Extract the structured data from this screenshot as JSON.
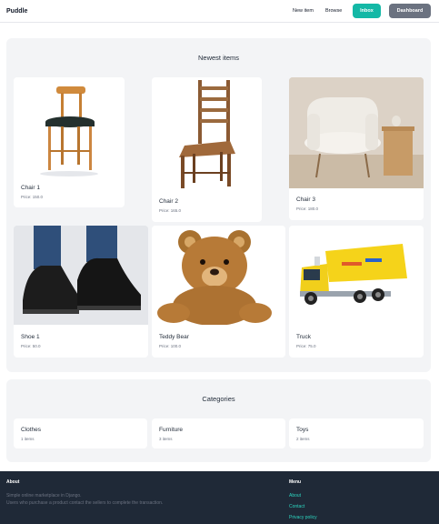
{
  "nav": {
    "brand": "Puddle",
    "new_item": "New item",
    "browse": "Browse",
    "inbox": "Inbox",
    "dashboard": "Dashboard"
  },
  "newest": {
    "title": "Newest items",
    "items": [
      {
        "name": "Chair 1",
        "price": "Price: 150.0",
        "image": "chair-1-image"
      },
      {
        "name": "Chair 2",
        "price": "Price: 165.0",
        "image": "chair-2-image"
      },
      {
        "name": "Chair 3",
        "price": "Price: 180.0",
        "image": "chair-3-image"
      },
      {
        "name": "Shoe 1",
        "price": "Price: 50.0",
        "image": "shoe-1-image"
      },
      {
        "name": "Teddy Bear",
        "price": "Price: 100.0",
        "image": "teddy-bear-image"
      },
      {
        "name": "Truck",
        "price": "Price: 75.0",
        "image": "truck-image"
      }
    ]
  },
  "categories": {
    "title": "Categories",
    "items": [
      {
        "name": "Clothes",
        "count": "1 items"
      },
      {
        "name": "Furniture",
        "count": "3 items"
      },
      {
        "name": "Toys",
        "count": "2 items"
      }
    ]
  },
  "footer": {
    "about_heading": "About",
    "about_line1": "Simple online marketplace in Django.",
    "about_line2": "Users who purchase a product contact the sellers to complete the transaction.",
    "menu_heading": "Menu",
    "links": [
      "About",
      "Contact",
      "Privacy policy"
    ]
  },
  "colors": {
    "accent": "#14b8a6",
    "dashboard_button": "#6b7280",
    "footer_bg": "#1f2937",
    "panel_bg": "#f3f4f6"
  }
}
